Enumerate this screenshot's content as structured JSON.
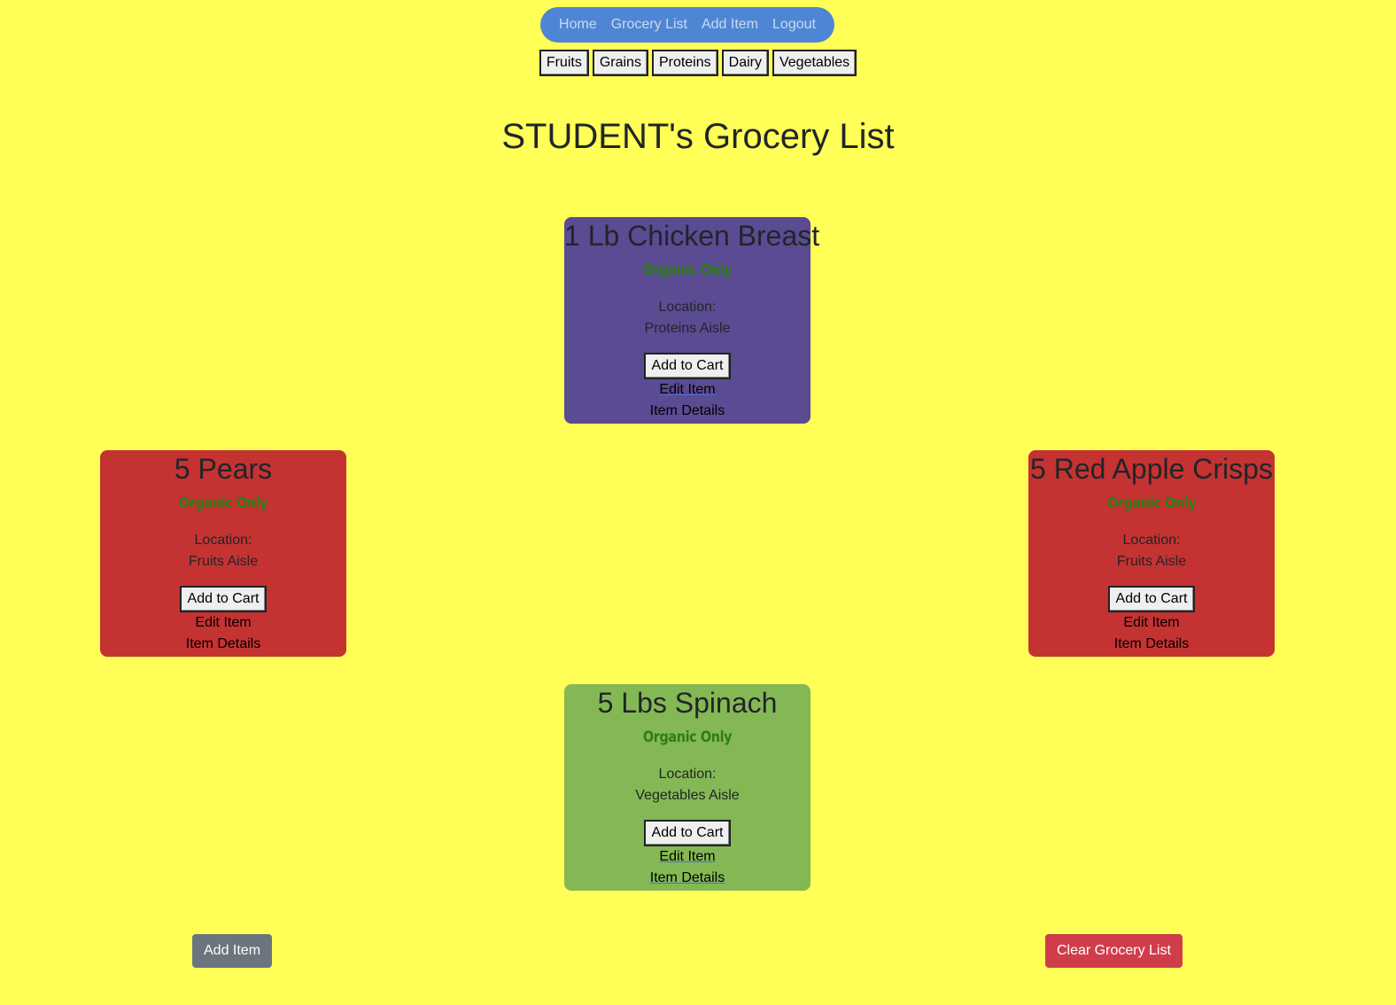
{
  "nav": {
    "links": [
      "Home",
      "Grocery List",
      "Add Item",
      "Logout"
    ]
  },
  "categories": [
    "Fruits",
    "Grains",
    "Proteins",
    "Dairy",
    "Vegetables"
  ],
  "page_title": "STUDENT's Grocery List",
  "cards": [
    {
      "name": "1 Lb Chicken Breast",
      "organic": "Organic Only",
      "location_label": "Location:",
      "location": "Proteins Aisle",
      "cart_label": "Add to Cart",
      "edit_label": "Edit Item",
      "details_label": "Item Details",
      "color": "#5a4b92"
    },
    {
      "name": "5 Pears",
      "organic": "Organic Only",
      "location_label": "Location:",
      "location": "Fruits Aisle",
      "cart_label": "Add to Cart",
      "edit_label": "Edit Item",
      "details_label": "Item Details",
      "color": "#c53232"
    },
    {
      "name": "5 Red Apple Crisps",
      "organic": "Organic Only",
      "location_label": "Location:",
      "location": "Fruits Aisle",
      "cart_label": "Add to Cart",
      "edit_label": "Edit Item",
      "details_label": "Item Details",
      "color": "#c53232"
    },
    {
      "name": "5 Lbs Spinach",
      "organic": "Organic Only",
      "location_label": "Location:",
      "location": "Vegetables Aisle",
      "cart_label": "Add to Cart",
      "edit_label": "Edit Item",
      "details_label": "Item Details",
      "color": "#84b854"
    }
  ],
  "footer": {
    "add_label": "Add Item",
    "clear_label": "Clear Grocery List"
  },
  "colors": {
    "background": "#ffff57",
    "nav": "#4f86d4",
    "add_button": "#6c757d",
    "clear_button": "#d03d4a",
    "organic_text": "#2e7d16"
  }
}
